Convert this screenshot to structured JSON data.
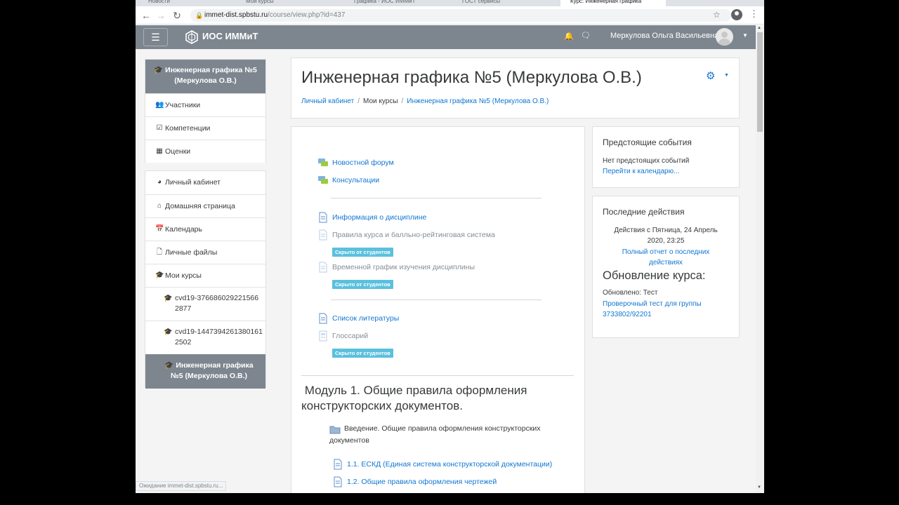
{
  "browser": {
    "tabs": [
      "Новости",
      "Мои курсы",
      "Графика - ИОС ИММиТ",
      "ГОСТ сервисы",
      "Курс: Инженерная графика"
    ],
    "url_host": "immet-dist.spbstu.ru",
    "url_path": "/course/view.php?id=437",
    "status_text": "Ожидание immet-dist.spbstu.ru..."
  },
  "navbar": {
    "brand": "ИОС ИММиТ",
    "user_name": "Меркулова Ольга Васильевна"
  },
  "sidebar": {
    "course_block": {
      "active_title": "Инженерная графика №5 (Меркулова О.В.)",
      "items": [
        {
          "label": "Участники",
          "icon": "users-icon"
        },
        {
          "label": "Компетенции",
          "icon": "checkbox-icon"
        },
        {
          "label": "Оценки",
          "icon": "table-icon"
        }
      ]
    },
    "nav_block": {
      "items": [
        {
          "label": "Личный кабинет",
          "icon": "dashboard-icon"
        },
        {
          "label": "Домашняя страница",
          "icon": "home-icon"
        },
        {
          "label": "Календарь",
          "icon": "calendar-icon"
        },
        {
          "label": "Личные файлы",
          "icon": "file-icon"
        },
        {
          "label": "Мои курсы",
          "icon": "graduation-cap-icon"
        }
      ],
      "courses": [
        "cvd19-3766860292215662877",
        "cvd19-14473942613801612502"
      ],
      "current_course": "Инженерная графика №5 (Меркулова О.В.)"
    }
  },
  "header": {
    "title": "Инженерная графика №5 (Меркулова О.В.)",
    "breadcrumb": [
      "Личный кабинет",
      "Мои курсы",
      "Инженерная графика №5 (Меркулова О.В.)"
    ]
  },
  "content": {
    "activities_top": [
      {
        "label": "Новостной форум",
        "type": "forum"
      },
      {
        "label": "Консультации",
        "type": "forum"
      }
    ],
    "activities_info": [
      {
        "label": "Информация о дисциплине",
        "type": "page",
        "hidden": false
      },
      {
        "label": "Правила курса и балльно-рейтинговая система",
        "type": "page",
        "hidden": true
      },
      {
        "label": "Временной график изучения дисциплины",
        "type": "page",
        "hidden": true
      }
    ],
    "activities_lit": [
      {
        "label": "Список литературы",
        "type": "page",
        "hidden": false
      },
      {
        "label": "Глоссарий",
        "type": "glossary",
        "hidden": true
      }
    ],
    "hidden_badge": "Скрыто от студентов",
    "module_title": "Модуль 1. Общие правила оформления конструкторских документов.",
    "module_items": [
      {
        "label": "Введение. Общие правила оформления конструкторских документов",
        "type": "folder"
      },
      {
        "label": "1.1. ЕСКД (Единая система конструкторской документации)",
        "type": "page"
      },
      {
        "label": "1.2.  Общие правила оформления чертежей",
        "type": "page"
      }
    ]
  },
  "right": {
    "events_title": "Предстоящие события",
    "events_none": "Нет предстоящих событий",
    "events_link": "Перейти к календарю...",
    "recent_title": "Последние действия",
    "recent_since_1": "Действия с Пятница, 24 Апрель",
    "recent_since_2": "2020, 23:25",
    "recent_full_1": "Полный отчет о последних",
    "recent_full_2": "действиях",
    "update_title": "Обновление курса:",
    "updated_label": "Обновлено: Тест",
    "updated_link_1": "Проверочный тест для группы",
    "updated_link_2": "3733802/92201"
  }
}
